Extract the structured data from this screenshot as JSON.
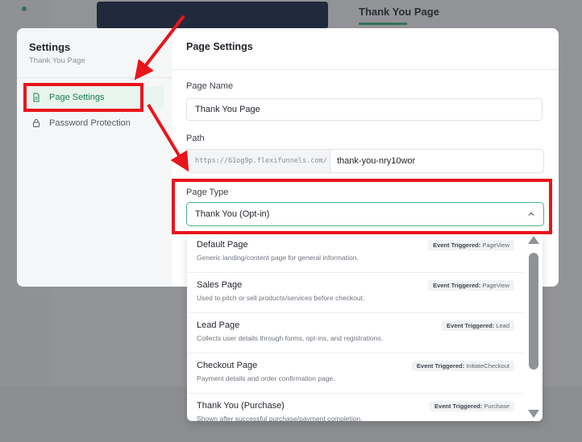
{
  "background": {
    "page_title": "Thank You Page"
  },
  "modal": {
    "sidebar": {
      "title": "Settings",
      "subtitle": "Thank You Page",
      "items": [
        {
          "label": "Page Settings",
          "icon": "document-icon",
          "active": true
        },
        {
          "label": "Password Protection",
          "icon": "lock-icon",
          "active": false
        }
      ]
    },
    "main": {
      "title": "Page Settings",
      "page_name_label": "Page Name",
      "page_name_value": "Thank You Page",
      "path_label": "Path",
      "path_prefix": "https://61og9p.flexifunnels.com/",
      "path_slug": "thank-you-nry10wor",
      "page_type_label": "Page Type",
      "page_type_value": "Thank You (Opt-in)"
    }
  },
  "dropdown": {
    "options": [
      {
        "name": "Default Page",
        "desc": "Generic landing/content page for general information.",
        "badge_key": "Event Triggered:",
        "badge_val": "PageView"
      },
      {
        "name": "Sales Page",
        "desc": "Used to pitch or sell products/services before checkout.",
        "badge_key": "Event Triggered:",
        "badge_val": "PageView"
      },
      {
        "name": "Lead Page",
        "desc": "Collects user details through forms, opt-ins, and registrations.",
        "badge_key": "Event Triggered:",
        "badge_val": "Lead"
      },
      {
        "name": "Checkout Page",
        "desc": "Payment details and order confirmation page.",
        "badge_key": "Event Triggered:",
        "badge_val": "InitiateCheckout"
      },
      {
        "name": "Thank You (Purchase)",
        "desc": "Shown after successful purchase/payment completion.",
        "badge_key": "Event Triggered:",
        "badge_val": "Purchase"
      }
    ]
  },
  "colors": {
    "accent": "#48b286",
    "annotation": "#e8151b"
  }
}
